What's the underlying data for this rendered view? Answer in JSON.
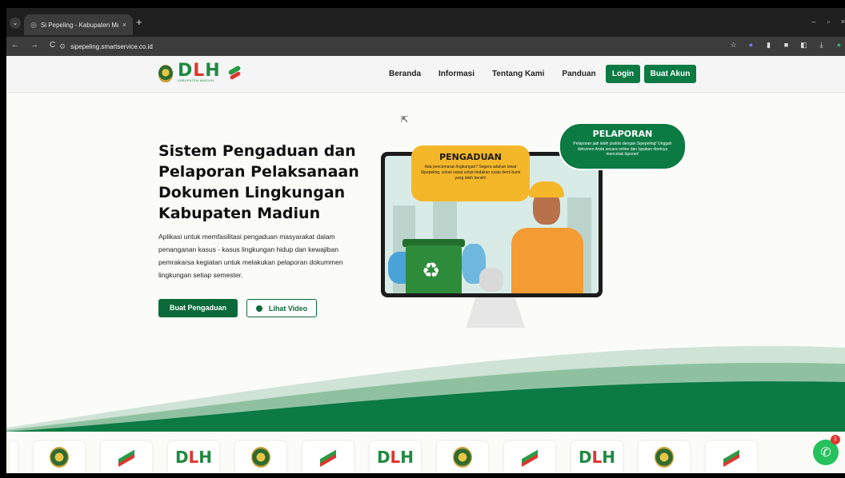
{
  "browser": {
    "tab_title": "Si Pepeling - Kabupaten Madiun",
    "tab_close": "×",
    "new_tab": "+",
    "url": "sipepeling.smartservice.co.id",
    "nav": {
      "back": "←",
      "forward": "→",
      "reload": "C",
      "site_info": "⚙"
    },
    "window_controls": {
      "minimize": "–",
      "restore": "▫",
      "close": "×"
    }
  },
  "header": {
    "logo_text_d": "D",
    "logo_text_l": "L",
    "logo_text_h": "H",
    "logo_subtitle": "KABUPATEN MADIUN",
    "menu": [
      "Beranda",
      "Informasi",
      "Tentang Kami",
      "Panduan"
    ],
    "login": "Login",
    "register": "Buat Akun"
  },
  "hero": {
    "title": "Sistem Pengaduan dan Pelaporan Pelaksanaan Dokumen Lingkungan Kabupaten Madiun",
    "description": "Aplikasi untuk memfasilitasi pengaduan masyarakat dalam penanganan kasus - kasus lingkungan hidup dan kewajiban pemrakarsa kegiatan untuk melakukan pelaporan dokummen lingkungan setiap semester.",
    "cta_primary": "Buat Pengaduan",
    "cta_secondary": "Lihat Video"
  },
  "illustration": {
    "pengaduan_title": "PENGADUAN",
    "pengaduan_text": "Ada pencemaran lingkungan? Segera adukan lewat Sipepeling, solusi cepat untuk tindakan nyata demi bumi yang lebih bersih!",
    "pelaporan_title": "PELAPORAN",
    "pelaporan_text": "Pelaporan jadi lebih praktis dengan Sipepeling! Unggah dokumen Anda secara online dan lupakan ribetnya mencetak laporan!"
  },
  "whatsapp": {
    "badge": "1"
  },
  "colors": {
    "brand_green": "#0b7a43",
    "brand_red": "#e0352f",
    "accent_yellow": "#f5b72a"
  }
}
